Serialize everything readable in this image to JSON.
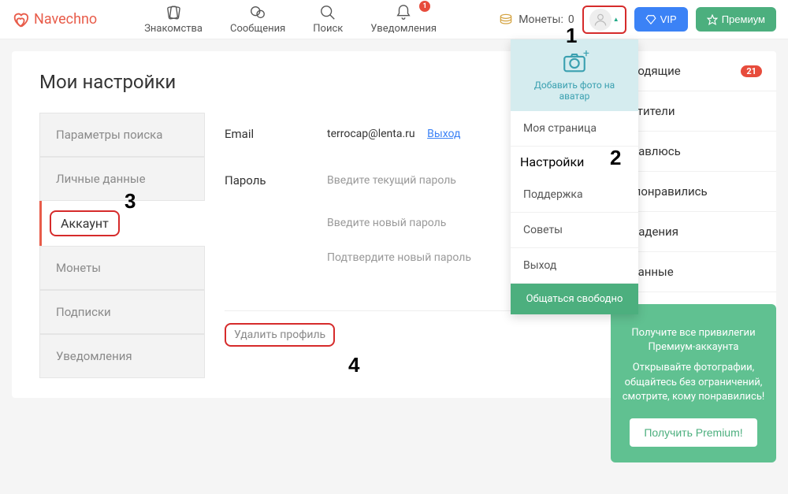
{
  "brand": "Navechno",
  "nav": {
    "dating": "Знакомства",
    "messages": "Сообщения",
    "search": "Поиск",
    "notifications": "Уведомления",
    "notif_badge": "1"
  },
  "header": {
    "coins_label": "Монеты:",
    "coins_value": "0",
    "vip": "VIP",
    "premium": "Премиум"
  },
  "page_title": "Мои настройки",
  "tabs": {
    "search_params": "Параметры поиска",
    "personal": "Личные данные",
    "account": "Аккаунт",
    "coins": "Монеты",
    "subscriptions": "Подписки",
    "notifications": "Уведомления"
  },
  "form": {
    "email_label": "Email",
    "email_value": "terrocap@lenta.ru",
    "logout": "Выход",
    "password_label": "Пароль",
    "current_pw": "Введите текущий пароль",
    "new_pw": "Введите новый пароль",
    "confirm_pw": "Подтвердите новый пароль",
    "delete": "Удалить профиль"
  },
  "dropdown": {
    "add_photo": "Добавить фото на аватар",
    "my_page": "Моя страница",
    "settings": "Настройки",
    "support": "Поддержка",
    "tips": "Советы",
    "logout": "Выход",
    "chat_free": "Общаться свободно"
  },
  "right": {
    "incoming": "дходящие",
    "incoming_count": "21",
    "visitors": "сетители",
    "i_like": "нравлюсь",
    "liked_me": "е понравились",
    "matches": "впадения",
    "favorites": "бранные"
  },
  "promo": {
    "line1": "Получите все привилегии Премиум-аккаунта",
    "line2": "Открывайте фотографии, общайтесь без ограничений, смотрите, кому понравились!",
    "button": "Получить Premium!"
  },
  "annotations": {
    "a1": "1",
    "a2": "2",
    "a3": "3",
    "a4": "4"
  }
}
